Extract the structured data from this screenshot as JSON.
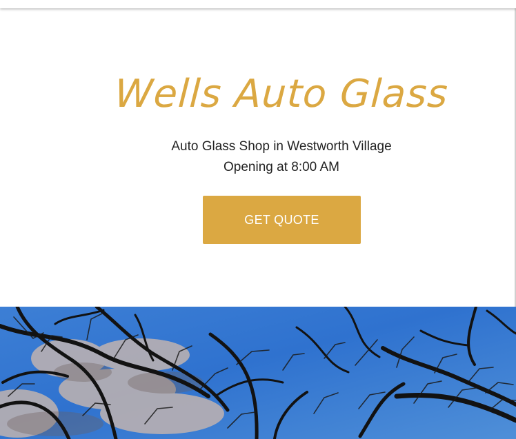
{
  "hero": {
    "business_name": "Wells Auto Glass",
    "subtitle": "Auto Glass Shop in Westworth Village",
    "hours": "Opening at 8:00 AM",
    "cta_label": "GET QUOTE"
  },
  "colors": {
    "accent": "#dba842",
    "text": "#222222",
    "sky": "#3f7fd0",
    "background": "#ffffff"
  },
  "banner": {
    "image_subject": "bare tree branches against blue sky"
  }
}
